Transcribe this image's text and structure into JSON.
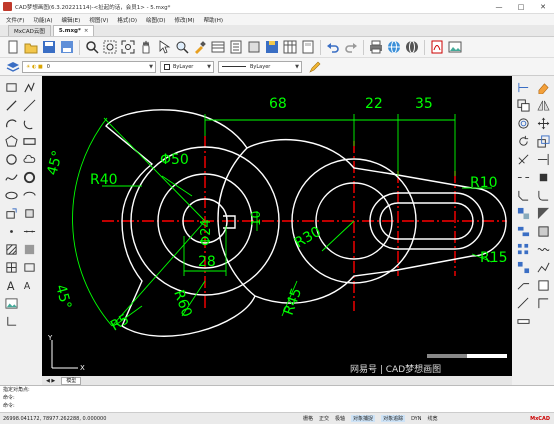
{
  "window": {
    "title": "CAD梦想画图(6.3.20221114)-<扯起的话，会员1> - 5.mxg*",
    "controls": [
      "—",
      "□",
      "✕"
    ]
  },
  "menu": [
    "文件(F)",
    "功能(A)",
    "编辑(E)",
    "视图(V)",
    "格式(O)",
    "绘图(D)",
    "修改(M)",
    "帮助(H)"
  ],
  "tabs": [
    {
      "label": "MxCAD云图",
      "active": false
    },
    {
      "label": "5.mxg*",
      "active": true,
      "close": "×"
    }
  ],
  "toolbar2": {
    "layer_value": "0",
    "color_value": "ByLayer",
    "linetype_value": "ByLayer"
  },
  "drawing": {
    "dimensions": [
      "68",
      "22",
      "35",
      "Φ50",
      "R40",
      "45°",
      "45°",
      "Φ24",
      "10",
      "28",
      "R30",
      "R10",
      "R15",
      "R5",
      "R60",
      "R45"
    ]
  },
  "layout": {
    "tab_label": "模型"
  },
  "command": {
    "lines": [
      "指定对角点:",
      "命令:",
      "命令:"
    ]
  },
  "status": {
    "coords": "26998.041172,  78977.262288,  0.000000",
    "toggles": [
      {
        "label": "栅格",
        "on": false
      },
      {
        "label": "正交",
        "on": false
      },
      {
        "label": "极轴",
        "on": false
      },
      {
        "label": "对象捕捉",
        "on": true
      },
      {
        "label": "对象追踪",
        "on": true
      },
      {
        "label": "DYN",
        "on": false
      },
      {
        "label": "线宽",
        "on": false
      }
    ],
    "brand": "MxCAD"
  },
  "watermark": "网易号 | CAD梦想画图",
  "colors": {
    "canvas_bg": "#000000",
    "outline": "#ffffff",
    "centerline": "#ff0000",
    "dimension": "#00ff00"
  }
}
